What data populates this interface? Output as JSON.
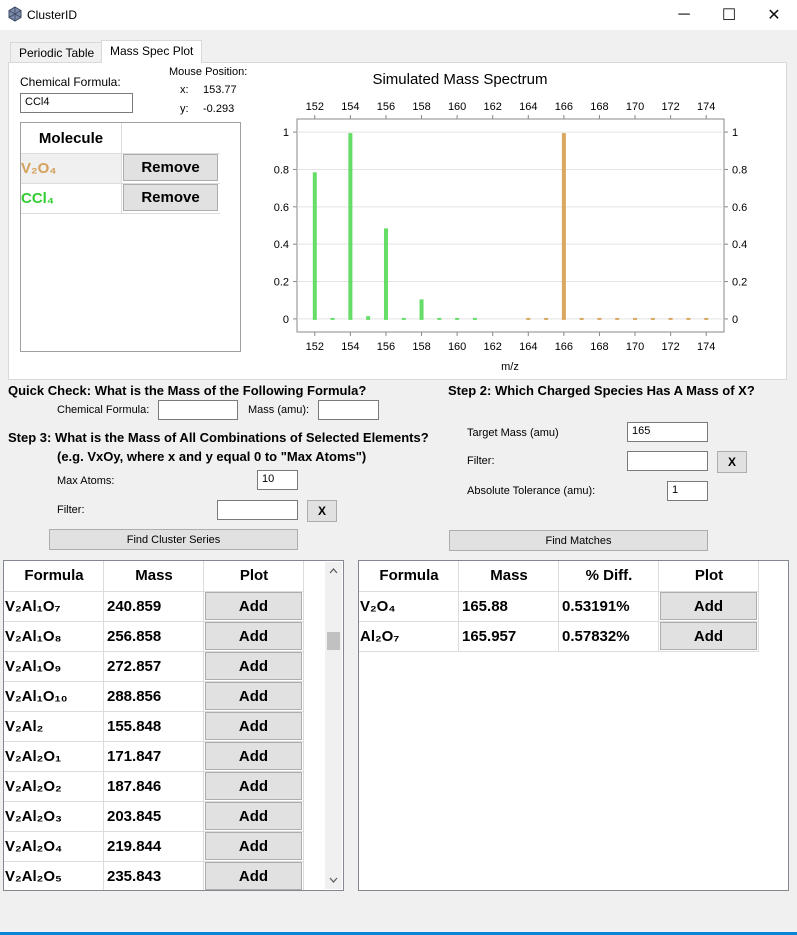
{
  "window": {
    "title": "ClusterID",
    "minimize": "─",
    "maximize": "☐",
    "close": "✕",
    "icon": "cluster-icon"
  },
  "tabs": [
    {
      "label": "Periodic Table"
    },
    {
      "label": "Mass Spec Plot"
    }
  ],
  "formula_input": {
    "label": "Chemical Formula:",
    "value": "CCl4"
  },
  "mouse": {
    "label": "Mouse Position:",
    "x_label": "x:",
    "x_value": "153.77",
    "y_label": "y:",
    "y_value": "-0.293"
  },
  "molecules": {
    "header": "Molecule",
    "rows": [
      {
        "formula": "V₂O₄",
        "color": "#d4a15a",
        "button": "Remove"
      },
      {
        "formula": "CCl₄",
        "color": "#33cc33",
        "button": "Remove"
      }
    ]
  },
  "chart_data": {
    "type": "bar",
    "title": "Simulated Mass Spectrum",
    "xlabel": "m/z",
    "ylabel": "",
    "xlim": [
      151,
      175
    ],
    "ylim": [
      -0.07,
      1.07
    ],
    "x_ticks": [
      "152",
      "154",
      "156",
      "158",
      "160",
      "162",
      "164",
      "166",
      "168",
      "170",
      "172",
      "174"
    ],
    "y_ticks": [
      "0",
      "0.2",
      "0.4",
      "0.6",
      "0.8",
      "1"
    ],
    "series": [
      {
        "color": "#66dd66",
        "x": [
          152,
          153,
          154,
          155,
          156,
          157,
          158,
          159,
          160,
          161
        ],
        "values": [
          0.79,
          0.01,
          1.0,
          0.02,
          0.49,
          0.01,
          0.11,
          0.0,
          0.01,
          0.0
        ]
      },
      {
        "color": "#d9a760",
        "x": [
          164,
          165,
          166,
          167,
          168,
          169,
          170,
          171,
          172,
          173,
          174
        ],
        "values": [
          0.0,
          0.01,
          1.0,
          0.0,
          0.01,
          0.0,
          0.0,
          0.0,
          0.0,
          0.0,
          0.0
        ]
      }
    ]
  },
  "quick_check": {
    "title": "Quick Check: What is the Mass of the Following Formula?",
    "formula_label": "Chemical Formula:",
    "formula_value": "",
    "mass_label": "Mass (amu):",
    "mass_value": ""
  },
  "step2": {
    "title": "Step 2: Which Charged Species Has A Mass of X?",
    "target_label": "Target Mass (amu)",
    "target_value": "165",
    "filter_label": "Filter:",
    "filter_value": "",
    "clear": "X",
    "tol_label": "Absolute Tolerance (amu):",
    "tol_value": "1",
    "find_button": "Find Matches"
  },
  "step3": {
    "title": "Step 3: What is the Mass of All Combinations of Selected Elements?",
    "subtitle": "(e.g. VxOy, where x and y equal 0 to \"Max Atoms\")",
    "max_label": "Max Atoms:",
    "max_value": "10",
    "filter_label": "Filter:",
    "filter_value": "",
    "clear": "X",
    "find_button": "Find Cluster Series"
  },
  "cluster_table": {
    "headers": [
      "Formula",
      "Mass",
      "Plot"
    ],
    "button": "Add",
    "rows": [
      {
        "formula": "V₂Al₁O₇",
        "mass": "240.859"
      },
      {
        "formula": "V₂Al₁O₈",
        "mass": "256.858"
      },
      {
        "formula": "V₂Al₁O₉",
        "mass": "272.857"
      },
      {
        "formula": "V₂Al₁O₁₀",
        "mass": "288.856"
      },
      {
        "formula": "V₂Al₂",
        "mass": "155.848"
      },
      {
        "formula": "V₂Al₂O₁",
        "mass": "171.847"
      },
      {
        "formula": "V₂Al₂O₂",
        "mass": "187.846"
      },
      {
        "formula": "V₂Al₂O₃",
        "mass": "203.845"
      },
      {
        "formula": "V₂Al₂O₄",
        "mass": "219.844"
      },
      {
        "formula": "V₂Al₂O₅",
        "mass": "235.843"
      }
    ]
  },
  "match_table": {
    "headers": [
      "Formula",
      "Mass",
      "% Diff.",
      "Plot"
    ],
    "button": "Add",
    "rows": [
      {
        "formula": "V₂O₄",
        "mass": "165.88",
        "diff": "0.53191%"
      },
      {
        "formula": "Al₂O₇",
        "mass": "165.957",
        "diff": "0.57832%"
      }
    ]
  }
}
